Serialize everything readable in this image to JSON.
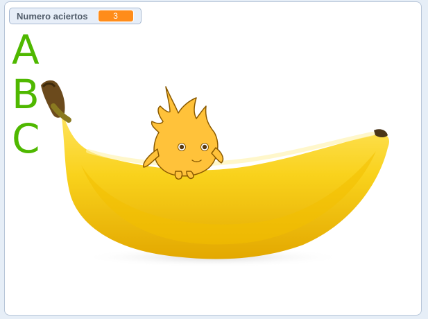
{
  "monitor": {
    "label": "Numero aciertos",
    "value": "3",
    "value_color": "#ff8c1a"
  },
  "letters": [
    "A",
    "B",
    "C"
  ],
  "letter_color": "#4fb800",
  "sprites": {
    "banana": "banana-backdrop",
    "character": "yellow-sprite-creature"
  }
}
